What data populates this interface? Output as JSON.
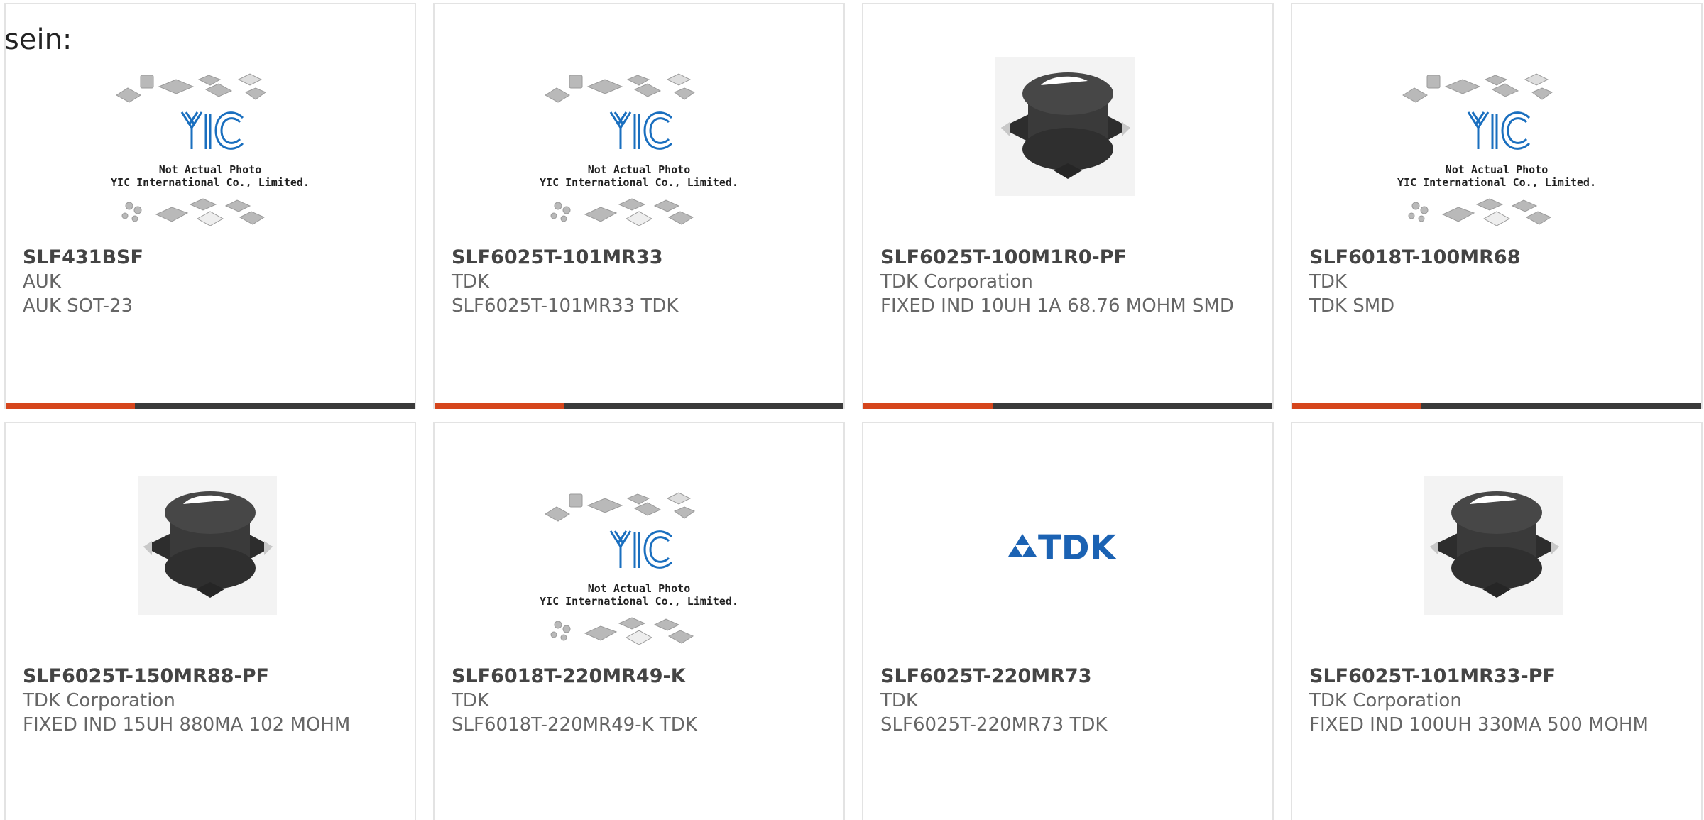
{
  "intro_text": "sein:",
  "colors": {
    "accent": "#d5451c",
    "bar_dark": "#3a3a3a",
    "tdk_blue": "#1b62b3"
  },
  "placeholder_image": {
    "line1": "Not Actual Photo",
    "line2": "YIC International Co., Limited."
  },
  "tdk_logo_text": "TDK",
  "products": [
    {
      "part_number": "SLF431BSF",
      "manufacturer": "AUK",
      "description": "AUK SOT-23",
      "image": "placeholder"
    },
    {
      "part_number": "SLF6025T-101MR33",
      "manufacturer": "TDK",
      "description": "SLF6025T-101MR33 TDK",
      "image": "placeholder"
    },
    {
      "part_number": "SLF6025T-100M1R0-PF",
      "manufacturer": "TDK Corporation",
      "description": "FIXED IND 10UH 1A 68.76 MOHM SMD",
      "image": "inductor"
    },
    {
      "part_number": "SLF6018T-100MR68",
      "manufacturer": "TDK",
      "description": "TDK SMD",
      "image": "placeholder"
    },
    {
      "part_number": "SLF6025T-150MR88-PF",
      "manufacturer": "TDK Corporation",
      "description": "FIXED IND 15UH 880MA 102 MOHM",
      "image": "inductor"
    },
    {
      "part_number": "SLF6018T-220MR49-K",
      "manufacturer": "TDK",
      "description": "SLF6018T-220MR49-K TDK",
      "image": "placeholder"
    },
    {
      "part_number": "SLF6025T-220MR73",
      "manufacturer": "TDK",
      "description": "SLF6025T-220MR73 TDK",
      "image": "tdk-logo"
    },
    {
      "part_number": "SLF6025T-101MR33-PF",
      "manufacturer": "TDK Corporation",
      "description": "FIXED IND 100UH 330MA 500 MOHM",
      "image": "inductor"
    }
  ]
}
